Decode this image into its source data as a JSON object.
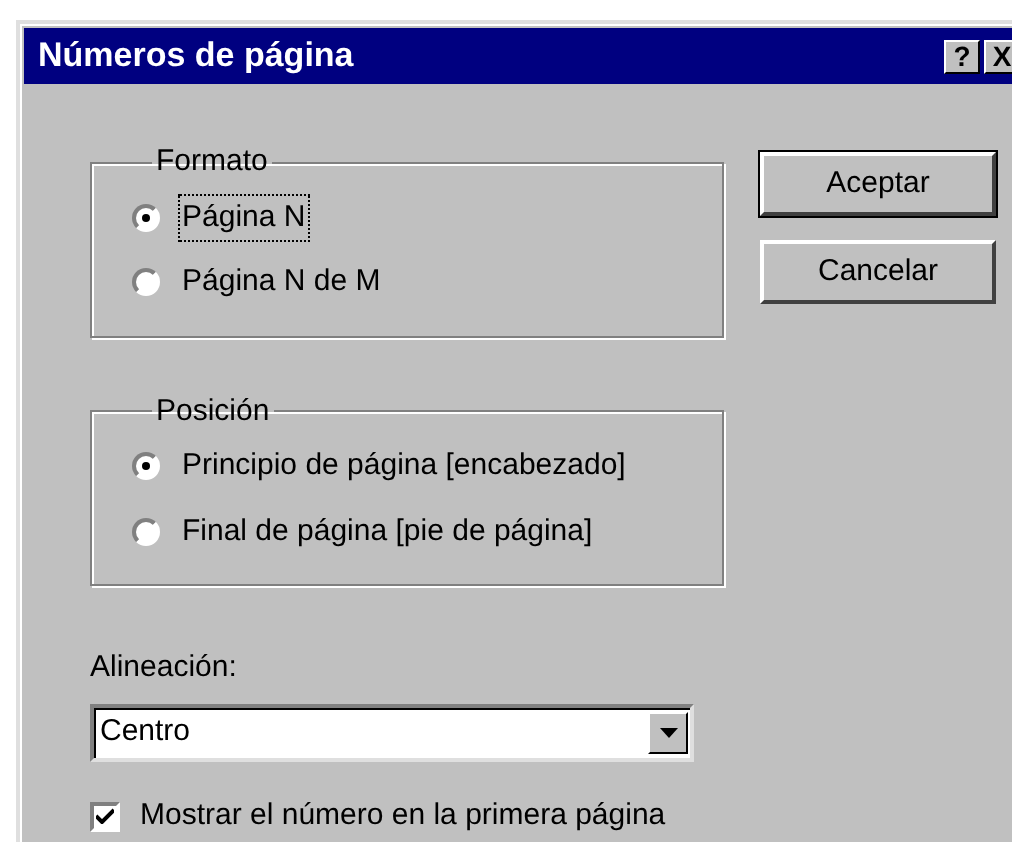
{
  "window": {
    "title": "Números de página"
  },
  "title_buttons": [
    {
      "label": "?"
    },
    {
      "label": "X"
    }
  ],
  "groups": [
    {
      "legend": "Formato",
      "options": [
        {
          "label": "Página N",
          "selected": true,
          "focused": true
        },
        {
          "label": "Página N de M",
          "selected": false,
          "focused": false
        }
      ]
    },
    {
      "legend": "Posición",
      "options": [
        {
          "label": "Principio de página [encabezado]",
          "selected": true,
          "focused": false
        },
        {
          "label": "Final de página [pie de página]",
          "selected": false,
          "focused": false
        }
      ]
    }
  ],
  "buttons": [
    {
      "label": "Aceptar",
      "default": true
    },
    {
      "label": "Cancelar",
      "default": false
    }
  ],
  "alignment": {
    "label": "Alineación:",
    "value": "Centro"
  },
  "first_page": {
    "label": "Mostrar el número en la primera página",
    "checked": true
  }
}
